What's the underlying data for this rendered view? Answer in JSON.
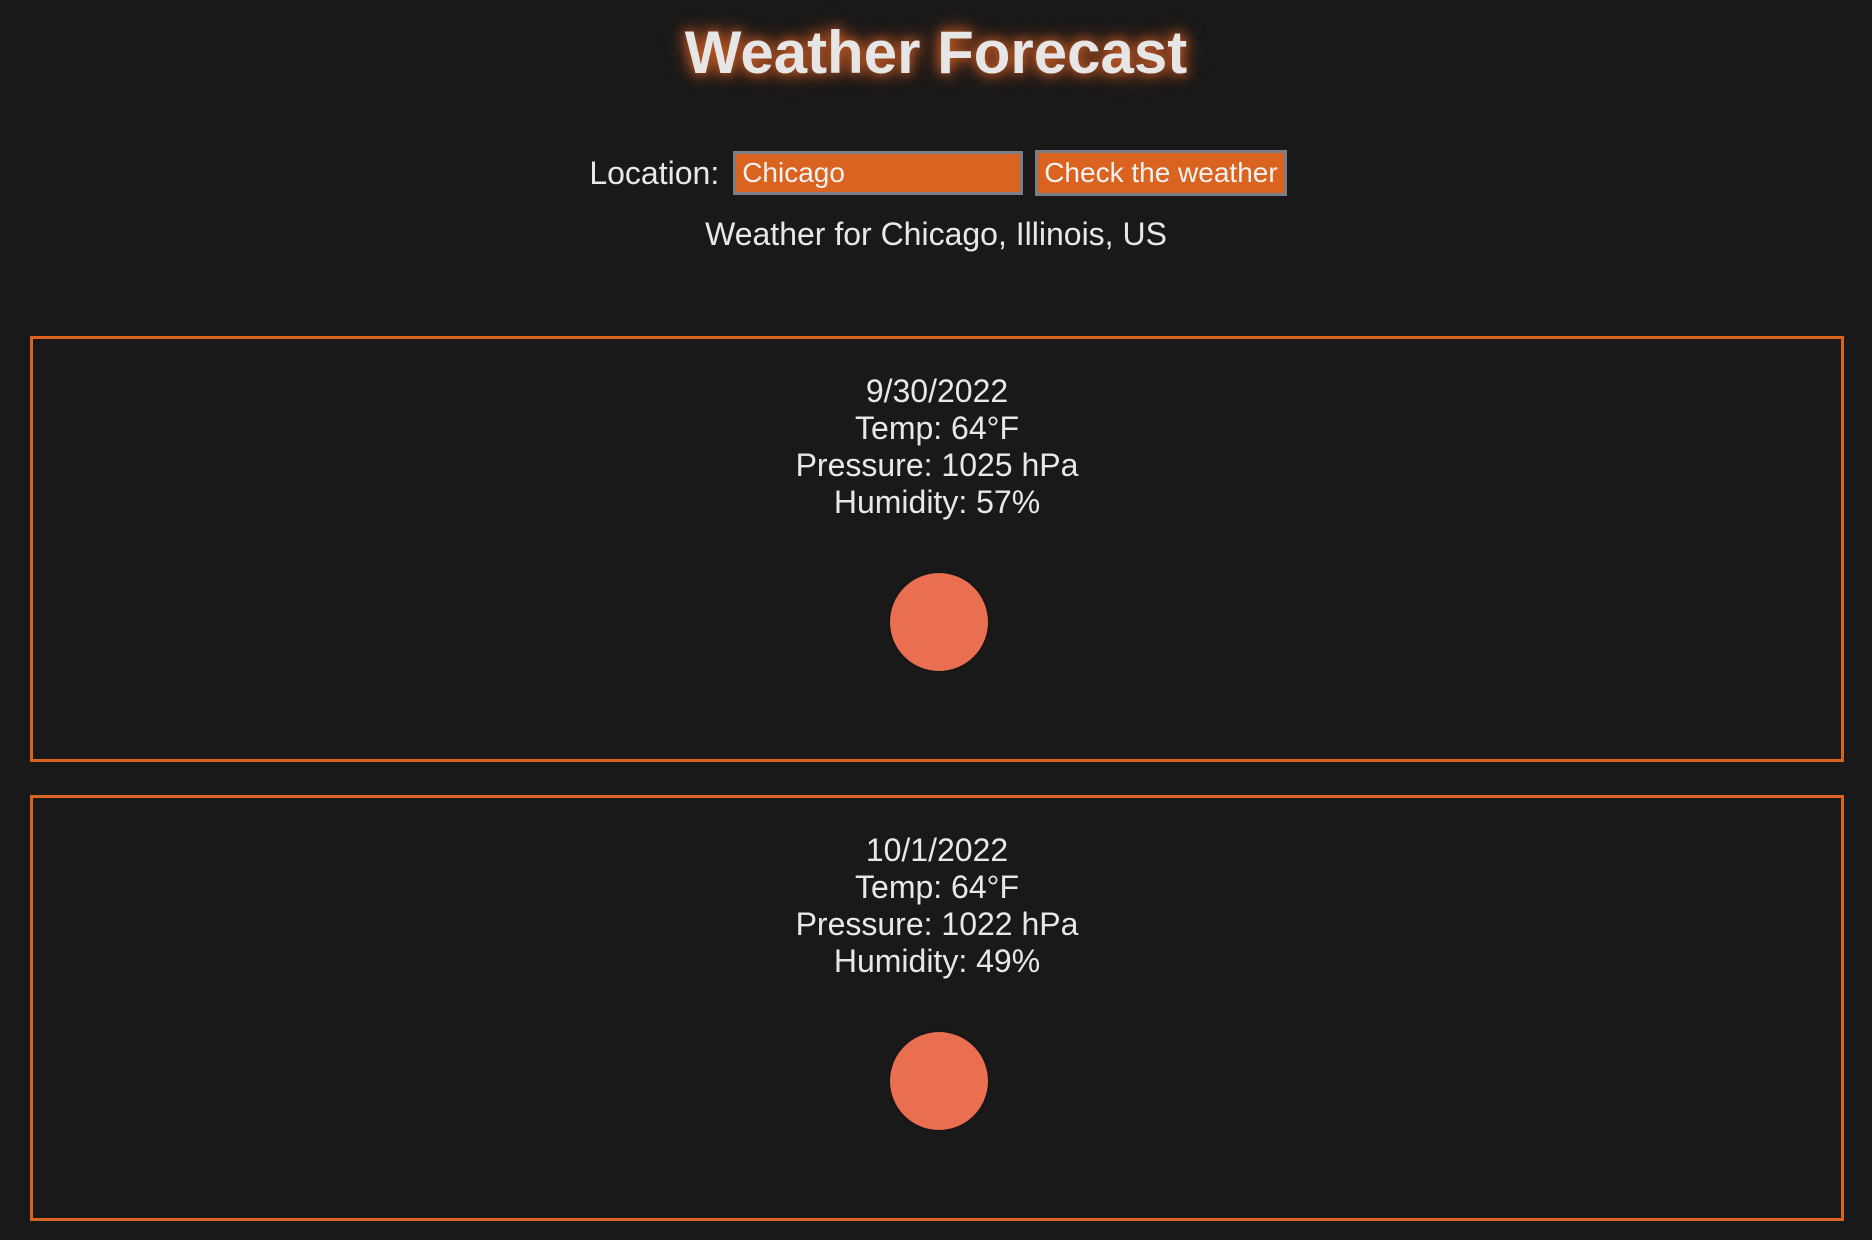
{
  "header": {
    "title": "Weather Forecast"
  },
  "search": {
    "label": "Location:",
    "value": "Chicago",
    "button_label": "Check the weather"
  },
  "result": {
    "heading": "Weather for Chicago, Illinois, US"
  },
  "forecast": [
    {
      "date": "9/30/2022",
      "temp": "Temp: 64°F",
      "pressure": "Pressure: 1025 hPa",
      "humidity": "Humidity: 57%",
      "icon": "sun-icon"
    },
    {
      "date": "10/1/2022",
      "temp": "Temp: 64°F",
      "pressure": "Pressure: 1022 hPa",
      "humidity": "Humidity: 49%",
      "icon": "sun-icon"
    }
  ],
  "colors": {
    "background": "#191919",
    "accent": "#d9631f",
    "sun": "#ea6e50",
    "text": "#e8e8e8"
  }
}
